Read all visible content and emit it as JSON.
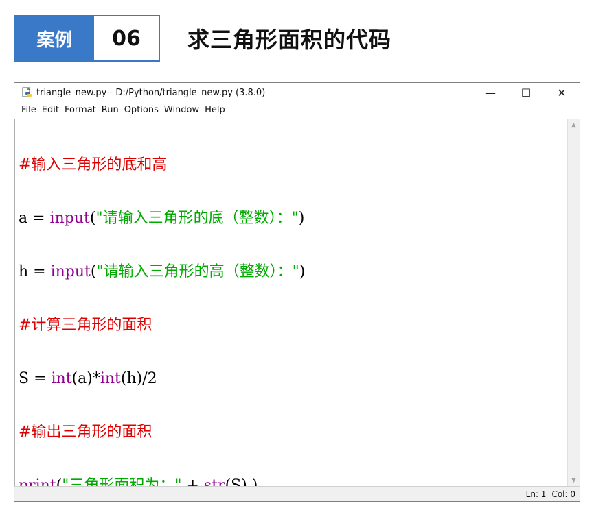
{
  "banner": {
    "tag_label": "案例",
    "tag_number": "06",
    "title": "求三角形面积的代码",
    "accent_color": "#3a78c8"
  },
  "window": {
    "title": "triangle_new.py - D:/Python/triangle_new.py (3.8.0)",
    "icon": "python-file-icon",
    "controls": {
      "minimize": "—",
      "maximize": "☐",
      "close": "✕"
    },
    "menu": [
      "File",
      "Edit",
      "Format",
      "Run",
      "Options",
      "Window",
      "Help"
    ]
  },
  "editor": {
    "line1": {
      "comment": "#输入三角形的底和高"
    },
    "line2": {
      "a": "a = ",
      "b": "input",
      "c": "(",
      "d": "\"请输入三角形的底（整数）：\"",
      "e": ")"
    },
    "line3": {
      "a": "h = ",
      "b": "input",
      "c": "(",
      "d": "\"请输入三角形的高（整数）：\"",
      "e": ")"
    },
    "line4": {
      "comment": "#计算三角形的面积"
    },
    "line5": {
      "a": "S = ",
      "b": "int",
      "c": "(a)*",
      "d": "int",
      "e": "(h)/2"
    },
    "line6": {
      "comment": "#输出三角形的面积"
    },
    "line7": {
      "a": "print",
      "b": "(",
      "c": "\"三角形面积为：\"",
      "d": " + ",
      "e": "str",
      "f": "(S) )"
    },
    "colors": {
      "comment": "#dd0000",
      "builtin": "#900090",
      "string": "#00aa00"
    }
  },
  "status": {
    "line": "Ln: 1",
    "col": "Col: 0"
  }
}
